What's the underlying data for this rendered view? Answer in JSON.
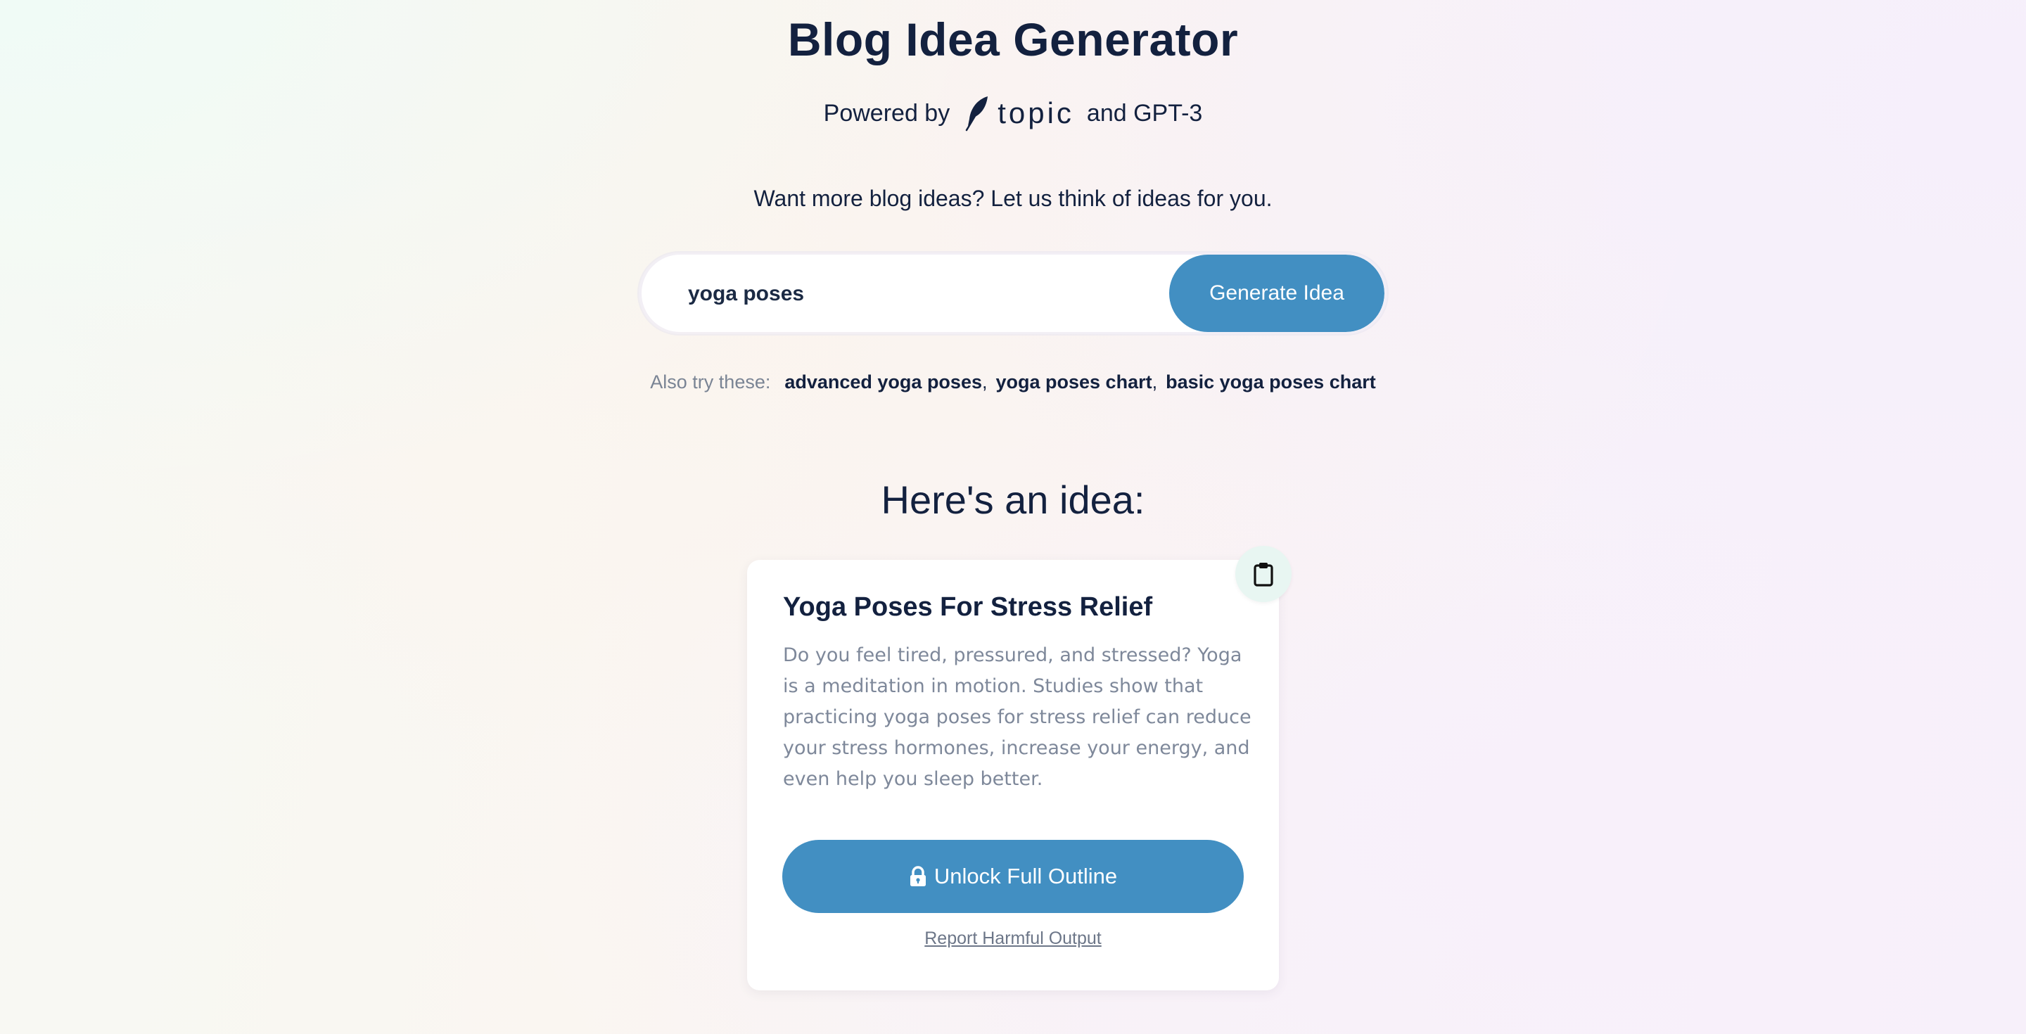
{
  "header": {
    "title": "Blog Idea Generator",
    "powered_prefix": "Powered by",
    "brand_name": "topic",
    "powered_suffix": "and GPT-3",
    "logo_icon": "feather-icon"
  },
  "intro": {
    "tagline": "Want more blog ideas? Let us think of ideas for you."
  },
  "search": {
    "value": "yoga poses",
    "placeholder": "",
    "button_label": "Generate Idea"
  },
  "suggestions": {
    "label": "Also try these:",
    "items": [
      "advanced yoga poses",
      "yoga poses chart",
      "basic yoga poses chart"
    ],
    "separator": ","
  },
  "result": {
    "heading": "Here's an idea:",
    "title": "Yoga Poses For Stress Relief",
    "body": "Do you feel tired, pressured, and stressed? Yoga is a meditation in motion. Studies show that practicing yoga poses for stress relief can reduce your stress hormones, increase your energy, and even help you sleep better.",
    "unlock_label": "Unlock Full Outline",
    "report_label": "Report Harmful Output",
    "copy_icon": "clipboard-icon",
    "lock_icon": "lock-icon"
  },
  "colors": {
    "accent": "#428fc2",
    "text_dark": "#13213f",
    "text_muted": "#7e889a",
    "copy_bg": "#e8f6f2"
  }
}
